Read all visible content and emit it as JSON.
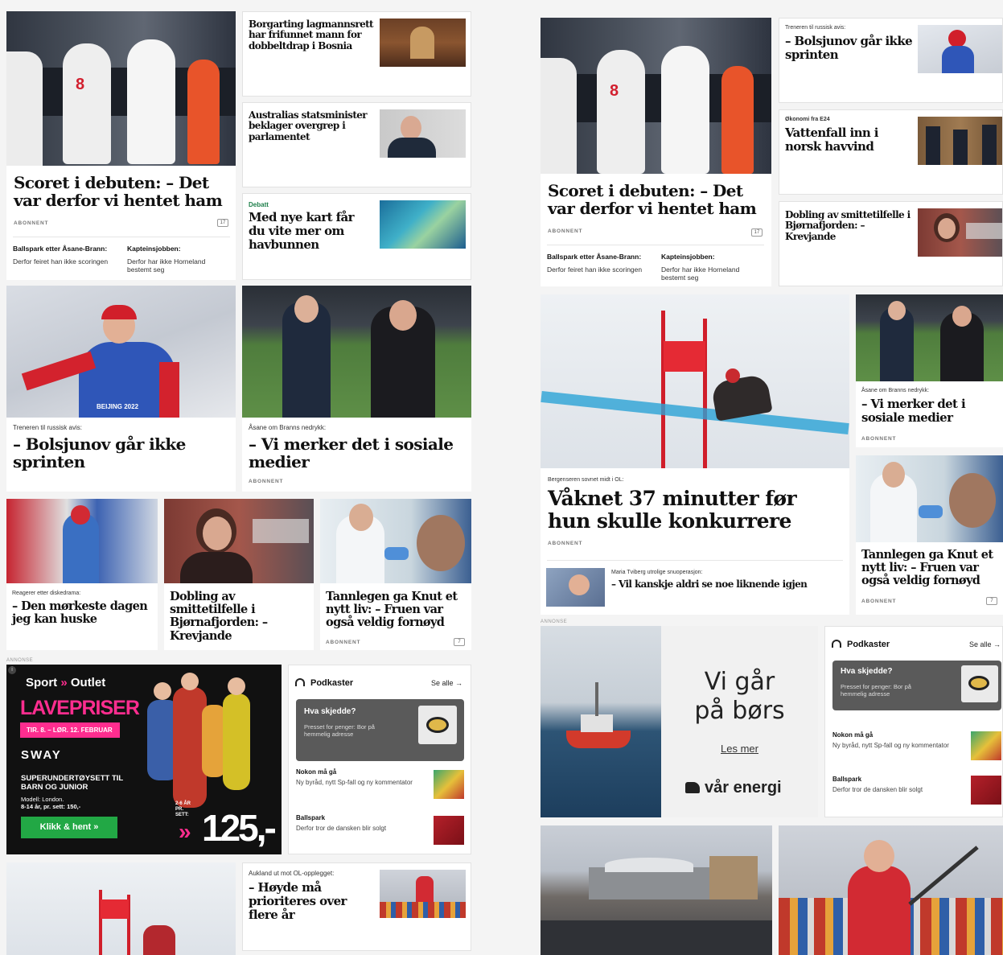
{
  "left": {
    "hero": {
      "headline": "Scoret i debuten: – Det var derfor vi hentet ham",
      "tag": "ABONNENT",
      "comments": "17",
      "sub1_title": "Ballspark etter Åsane-Brann:",
      "sub1_text": "Derfor feiret han ikke scoringen",
      "sub2_title": "Kapteinsjobben:",
      "sub2_text": "Derfor har ikke Horneland bestemt seg"
    },
    "side1": {
      "headline": "Borgarting lagmannsrett har frifunnet mann for dobbeltdrap i Bosnia"
    },
    "side2": {
      "headline": "Australias statsminister beklager overgrep i parlamentet"
    },
    "side3": {
      "label": "Debatt",
      "headline": "Med nye kart får du vite mer om havbunnen"
    },
    "ski1": {
      "kicker": "Treneren til russisk avis:",
      "headline": "– Bolsjunov går ikke sprinten",
      "bib": "BEIJING 2022"
    },
    "brann": {
      "kicker": "Åsane om Branns nedrykk:",
      "headline": "– Vi merker det i sosiale medier",
      "tag": "ABONNENT"
    },
    "small1": {
      "kicker": "Reagerer etter diskedrama:",
      "headline": "– Den mørkeste dagen jeg kan huske"
    },
    "small2": {
      "headline": "Dobling av smittetilfelle i Bjørnafjorden: – Krevjande"
    },
    "small3": {
      "headline": "Tannlegen ga Knut et nytt liv: – Fruen var også veldig fornøyd",
      "tag": "ABONNENT",
      "comments": "7"
    },
    "ad": {
      "annonse": "ANNONSE",
      "brand": "Sport",
      "brand2": "Outlet",
      "lave": "LAVEPRISER",
      "dates": "TIR. 8. – LØR. 12. FEBRUAR",
      "sway": "SWAY",
      "super": "SUPERUNDERTØYSETT TIL BARN OG JUNIOR",
      "model": "Modell: London.",
      "size": "8-14 år, pr. sett: 150,-",
      "btn": "Klikk & hent »",
      "ages": "2-6 ÅR PR. SETT:",
      "price": "125,-"
    },
    "pod": {
      "title": "Podkaster",
      "seeall": "Se alle →",
      "feat_title": "Hva skjedde?",
      "feat_text": "Presset for penger: Bor på hemmelig adresse",
      "r1_title": "Nokon må gå",
      "r1_text": "Ny byråd, nytt Sp-fall og ny kommentator",
      "r2_title": "Ballspark",
      "r2_text": "Derfor tror de dansken blir solgt"
    },
    "bottom": {
      "kicker": "Aukland ut mot OL-opplegget:",
      "headline": "– Høyde må prioriteres over flere år"
    }
  },
  "right": {
    "hero": {
      "headline": "Scoret i debuten: – Det var derfor vi hentet ham",
      "tag": "ABONNENT",
      "comments": "17",
      "sub1_title": "Ballspark etter Åsane-Brann:",
      "sub1_text": "Derfor feiret han ikke scoringen",
      "sub2_title": "Kapteinsjobben:",
      "sub2_text": "Derfor har ikke Horneland bestemt seg"
    },
    "side1": {
      "kicker": "Treneren til russisk avis:",
      "headline": "– Bolsjunov går ikke sprinten"
    },
    "side2": {
      "kicker": "Økonomi fra E24",
      "headline": "Vattenfall inn i norsk havvind"
    },
    "side3": {
      "headline": "Dobling av smittetilfelle i Bjørnafjorden: – Krevjande"
    },
    "olymp": {
      "kicker": "Bergenseren sovnet midt i OL:",
      "headline": "Våknet 37 minutter før hun skulle konkurrere",
      "tag": "ABONNENT",
      "sub_kicker": "Maria Tviberg utrolige snuoperasjon:",
      "sub_headline": "– Vil kanskje aldri se noe liknende igjen"
    },
    "brann": {
      "kicker": "Åsane om Branns nedrykk:",
      "headline": "– Vi merker det i sosiale medier",
      "tag": "ABONNENT"
    },
    "tann": {
      "headline": "Tannlegen ga Knut et nytt liv: – Fruen var også veldig fornøyd",
      "tag": "ABONNENT",
      "comments": "7"
    },
    "ad": {
      "annonse": "ANNONSE",
      "line1": "Vi går",
      "line2": "på børs",
      "link": "Les mer",
      "brand": "vår energi"
    },
    "pod": {
      "title": "Podkaster",
      "seeall": "Se alle →",
      "feat_title": "Hva skjedde?",
      "feat_text": "Presset for penger: Bor på hemmelig adresse",
      "r1_title": "Nokon må gå",
      "r1_text": "Ny byråd, nytt Sp-fall og ny kommentator",
      "r2_title": "Ballspark",
      "r2_text": "Derfor tror de dansken blir solgt"
    }
  },
  "colors": {
    "ad_black": "#111111",
    "ad_pink": "#ff2d8f",
    "ad_green": "#22a845",
    "pod_dark": "#555555",
    "debatt_green": "#1e7f4a"
  }
}
